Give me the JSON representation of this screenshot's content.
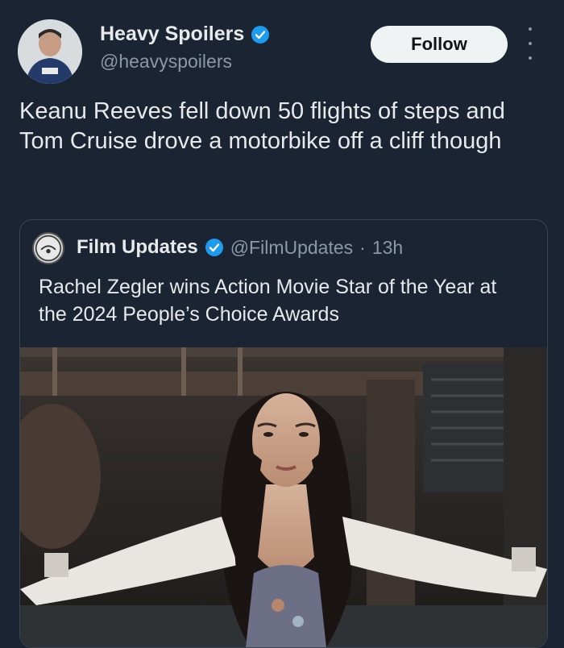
{
  "author": {
    "display_name": "Heavy Spoilers",
    "handle": "@heavyspoilers",
    "verified": true
  },
  "buttons": {
    "follow_label": "Follow",
    "more_icon": "more-vertical-icon"
  },
  "tweet": {
    "text": "Keanu Reeves fell down 50 flights of steps and Tom Cruise drove a motorbike off a cliff though"
  },
  "quoted": {
    "display_name": "Film Updates",
    "handle": "@FilmUpdates",
    "separator": "·",
    "time": "13h",
    "verified": true,
    "text": "Rachel Zegler wins Action Movie Star of the Year at the 2024 People’s Choice Awards",
    "media_icon": "photo-image-icon"
  },
  "colors": {
    "background": "#1b2432",
    "verified_blue": "#1d9bf0",
    "follow_bg": "#eff3f4",
    "muted_text": "#8b98a5"
  }
}
